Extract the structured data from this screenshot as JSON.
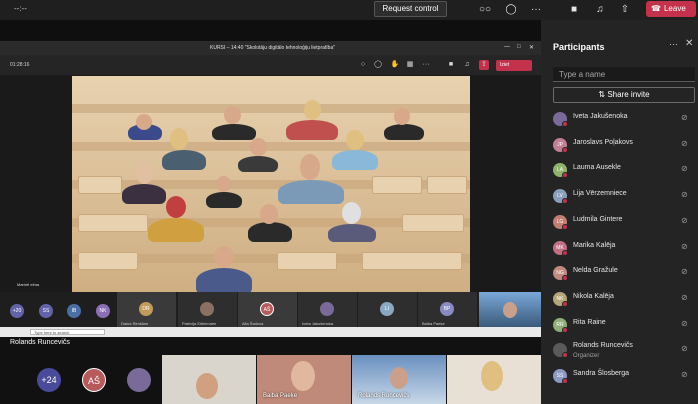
{
  "topbar": {
    "timer": "--:--",
    "request_control": "Request control",
    "leave": "Leave",
    "icons": [
      "people-icon",
      "chat-icon",
      "more-icon",
      "camera-icon",
      "mic-icon",
      "share-icon",
      "phone-icon"
    ]
  },
  "inner_window": {
    "caption": "KURSI – 14:40 \"Skolotāju digitālo tehnoloģiju lietpratība\"",
    "time": "01:28:16",
    "leave": "Iziet",
    "presenter_name": "Marinē elma"
  },
  "strip": {
    "overflow": "+20",
    "avatars": [
      {
        "initials": "SS",
        "color": "#6264a7"
      },
      {
        "initials": "IB",
        "color": "#4a6fa5"
      },
      {
        "initials": "NK",
        "color": "#8a6fb5"
      }
    ],
    "tiles": [
      {
        "initials": "DR",
        "label": "Daina Rimšāne"
      },
      {
        "initials": "",
        "label": "Patricija Ešteimaire"
      },
      {
        "initials": "AŠ",
        "label": "Alla Šaduva"
      },
      {
        "initials": "",
        "label": "Iveta Jakušenoka"
      },
      {
        "initials": "LI",
        "label": "Lauma Ausekle"
      },
      {
        "initials": "BP",
        "label": "Baiba Paeķe"
      }
    ],
    "search_placeholder": "Type here to search"
  },
  "bottom": {
    "name": "Rolands Runcevičs",
    "overflow": "+24",
    "initials": "AŠ",
    "labels": [
      "Baiba Paeķe",
      "Rolands Runcevičs"
    ]
  },
  "panel": {
    "title": "Participants",
    "search_placeholder": "Type a name",
    "invite": "Share invite",
    "participants": [
      {
        "name": "Iveta Jakušenoka",
        "initials": "",
        "color": "#7a6a9a",
        "role": "",
        "status": "busy",
        "photo": true
      },
      {
        "name": "Jaroslavs Poļakovs",
        "initials": "JP",
        "color": "#c27e92",
        "role": "",
        "status": "busy",
        "photo": false
      },
      {
        "name": "Lauma Ausekle",
        "initials": "LA",
        "color": "#8fb36a",
        "role": "",
        "status": "busy",
        "photo": false
      },
      {
        "name": "Lija Vērzemniece",
        "initials": "LV",
        "color": "#8aa0b8",
        "role": "",
        "status": "busy",
        "photo": false
      },
      {
        "name": "Ludmila Gintere",
        "initials": "LG",
        "color": "#c27e70",
        "role": "",
        "status": "busy",
        "photo": false
      },
      {
        "name": "Marika Kalēja",
        "initials": "MK",
        "color": "#c26f82",
        "role": "",
        "status": "busy",
        "photo": false
      },
      {
        "name": "Nelda Gražule",
        "initials": "NG",
        "color": "#c28a7e",
        "role": "",
        "status": "busy",
        "photo": false
      },
      {
        "name": "Nikola Kalēja",
        "initials": "NK",
        "color": "#b5a67a",
        "role": "",
        "status": "busy",
        "photo": false
      },
      {
        "name": "Rita Raine",
        "initials": "RR",
        "color": "#8fae7a",
        "role": "",
        "status": "busy",
        "photo": false
      },
      {
        "name": "Rolands Runcevičs",
        "initials": "",
        "color": "#5a5a5a",
        "role": "Organizer",
        "status": "busy",
        "photo": true
      },
      {
        "name": "Sandra Šlosberga",
        "initials": "SS",
        "color": "#8a9ac2",
        "role": "",
        "status": "busy",
        "photo": false
      }
    ]
  }
}
